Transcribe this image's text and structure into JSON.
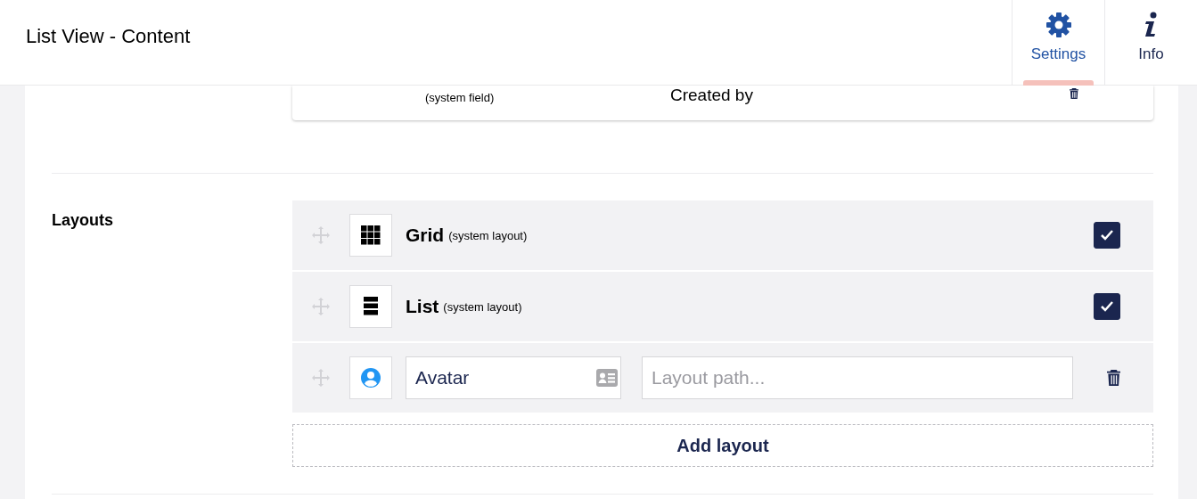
{
  "header": {
    "title": "List View - Content",
    "tabs": [
      {
        "label": "Settings",
        "selected": true
      },
      {
        "label": "Info",
        "selected": false
      }
    ]
  },
  "columns_card": {
    "rows": [
      {
        "note": "(system field)",
        "name": "Created by"
      }
    ]
  },
  "layouts": {
    "label": "Layouts",
    "items": [
      {
        "kind": "system",
        "name": "Grid",
        "note": "(system layout)",
        "checked": true
      },
      {
        "kind": "system",
        "name": "List",
        "note": "(system layout)",
        "checked": true
      },
      {
        "kind": "custom",
        "value": "Avatar",
        "placeholder": "Layout path..."
      }
    ],
    "add_button": "Add layout"
  }
}
